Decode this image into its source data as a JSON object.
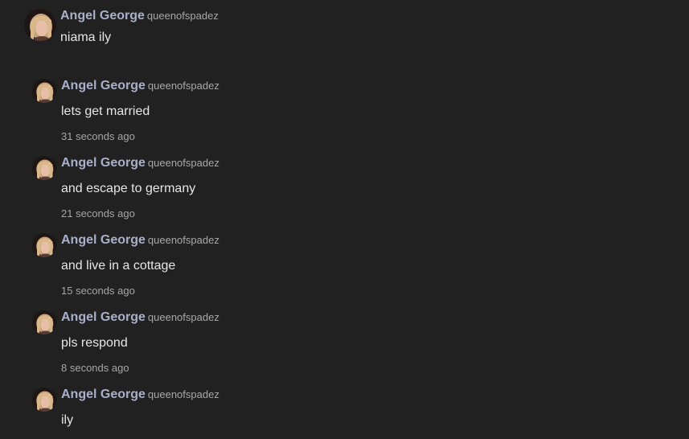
{
  "thread": {
    "post": {
      "author": "Angel George",
      "handle": "queenofspadez",
      "text": "niama ily",
      "avatar_icon": "user-avatar"
    },
    "replies": [
      {
        "author": "Angel George",
        "handle": "queenofspadez",
        "text": "lets get married",
        "time": "31 seconds ago"
      },
      {
        "author": "Angel George",
        "handle": "queenofspadez",
        "text": "and escape to germany",
        "time": "21 seconds ago"
      },
      {
        "author": "Angel George",
        "handle": "queenofspadez",
        "text": "and live in a cottage",
        "time": "15 seconds ago"
      },
      {
        "author": "Angel George",
        "handle": "queenofspadez",
        "text": "pls respond",
        "time": "8 seconds ago"
      },
      {
        "author": "Angel George",
        "handle": "queenofspadez",
        "text": "ily",
        "time": ""
      }
    ]
  },
  "colors": {
    "background": "#212121",
    "author": "#a9b0c8",
    "text": "#e6e6e6",
    "muted": "#a6a6a6"
  }
}
